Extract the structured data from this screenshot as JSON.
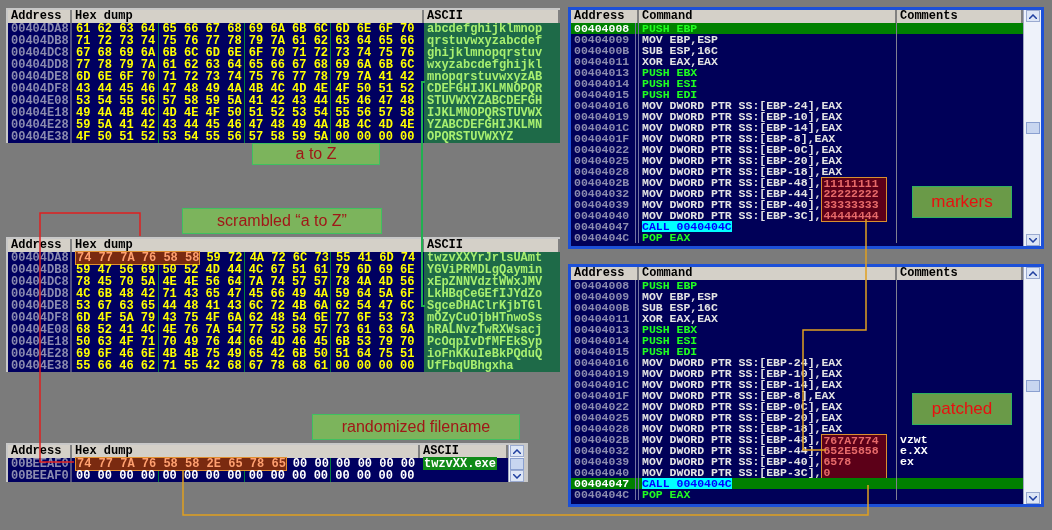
{
  "hex_panels": [
    {
      "columns": [
        "Address",
        "Hex dump",
        "ASCII"
      ],
      "rows": [
        {
          "address": "00404DA8",
          "hex": "61 62 63 64 65 66 67 68 69 6A 6B 6C 6D 6E 6F 70",
          "ascii": "abcdefghijklmnop"
        },
        {
          "address": "00404DB8",
          "hex": "71 72 73 74 75 76 77 78 79 7A 61 62 63 64 65 66",
          "ascii": "qrstuvwxyzabcdef"
        },
        {
          "address": "00404DC8",
          "hex": "67 68 69 6A 6B 6C 6D 6E 6F 70 71 72 73 74 75 76",
          "ascii": "ghijklmnopqrstuv"
        },
        {
          "address": "00404DD8",
          "hex": "77 78 79 7A 61 62 63 64 65 66 67 68 69 6A 6B 6C",
          "ascii": "wxyzabcdefghijkl"
        },
        {
          "address": "00404DE8",
          "hex": "6D 6E 6F 70 71 72 73 74 75 76 77 78 79 7A 41 42",
          "ascii": "mnopqrstuvwxyzAB"
        },
        {
          "address": "00404DF8",
          "hex": "43 44 45 46 47 48 49 4A 4B 4C 4D 4E 4F 50 51 52",
          "ascii": "CDEFGHIJKLMNOPQR"
        },
        {
          "address": "00404E08",
          "hex": "53 54 55 56 57 58 59 5A 41 42 43 44 45 46 47 48",
          "ascii": "STUVWXYZABCDEFGH"
        },
        {
          "address": "00404E18",
          "hex": "49 4A 4B 4C 4D 4E 4F 50 51 52 53 54 55 56 57 58",
          "ascii": "IJKLMNOPQRSTUVWX"
        },
        {
          "address": "00404E28",
          "hex": "59 5A 41 42 43 44 45 46 47 48 49 4A 4B 4C 4D 4E",
          "ascii": "YZABCDEFGHIJKLMN"
        },
        {
          "address": "00404E38",
          "hex": "4F 50 51 52 53 54 55 56 57 58 59 5A 00 00 00 00",
          "ascii": "OPQRSTUVWXYZ"
        }
      ]
    },
    {
      "columns": [
        "Address",
        "Hex dump",
        "ASCII"
      ],
      "rows": [
        {
          "address": "00404DA8",
          "marked": "74 77 7A 76 58 58",
          "hex": "59 72 4A 72 6C 73 55 41 6D 74",
          "ascii": "twzvXXYrJrlsUAmt"
        },
        {
          "address": "00404DB8",
          "hex": "59 47 56 69 50 52 4D 44 4C 67 51 61 79 6D 69 6E",
          "ascii": "YGViPRMDLgQaymin"
        },
        {
          "address": "00404DC8",
          "hex": "78 45 70 5A 4E 4E 56 64 7A 74 57 57 78 4A 4D 56",
          "ascii": "xEpZNNVdztWWxJMV"
        },
        {
          "address": "00404DD8",
          "hex": "4C 6B 48 42 71 43 65 47 45 66 49 4A 59 64 5A 6F",
          "ascii": "LkHBqCeGEfIJYdZo"
        },
        {
          "address": "00404DE8",
          "hex": "53 67 63 65 44 48 41 43 6C 72 4B 6A 62 54 47 6C",
          "ascii": "SgceDHAClrKjbTGl"
        },
        {
          "address": "00404DF8",
          "hex": "6D 4F 5A 79 43 75 4F 6A 62 48 54 6E 77 6F 53 73",
          "ascii": "mOZyCuOjbHTnwoSs"
        },
        {
          "address": "00404E08",
          "hex": "68 52 41 4C 4E 76 7A 54 77 52 58 57 73 61 63 6A",
          "ascii": "hRALNvzTwRXWsacj"
        },
        {
          "address": "00404E18",
          "hex": "50 63 4F 71 70 49 76 44 66 4D 46 45 6B 53 79 70",
          "ascii": "PcOqpIvDfMFEkSyp"
        },
        {
          "address": "00404E28",
          "hex": "69 6F 46 6E 4B 4B 75 49 65 42 6B 50 51 64 75 51",
          "ascii": "ioFnKKuIeBkPQduQ"
        },
        {
          "address": "00404E38",
          "hex": "55 66 46 62 71 55 42 68 67 78 68 61 00 00 00 00",
          "ascii": "UfFbqUBhgxha"
        }
      ]
    },
    {
      "columns": [
        "Address",
        "Hex dump",
        "ASCII"
      ],
      "rows": [
        {
          "address": "00BEEAE0",
          "marked": "74 77 7A 76 58 58 2E 65 78 65",
          "hex": "00 00 00 00 00 00",
          "ascii": "twzvXX.exe"
        },
        {
          "address": "00BEEAF0",
          "hex": "00 00 00 00 00 00 00 00 00 00 00 00 00 00 00 00"
        }
      ]
    }
  ],
  "disasm_panels": [
    {
      "columns": [
        "Address",
        "Command",
        "Comments"
      ],
      "rows": [
        {
          "address": "00404008",
          "command": "PUSH EBP",
          "kind": "stack",
          "selected": true
        },
        {
          "address": "00404009",
          "command": "MOV EBP,ESP",
          "kind": "plain",
          "selected": false
        },
        {
          "address": "0040400B",
          "command": "SUB ESP,16C",
          "kind": "plain",
          "selected": false
        },
        {
          "address": "00404011",
          "command": "XOR EAX,EAX",
          "kind": "plain",
          "selected": false
        },
        {
          "address": "00404013",
          "command": "PUSH EBX",
          "kind": "stack",
          "selected": false
        },
        {
          "address": "00404014",
          "command": "PUSH ESI",
          "kind": "stack",
          "selected": false
        },
        {
          "address": "00404015",
          "command": "PUSH EDI",
          "kind": "stack",
          "selected": false
        },
        {
          "address": "00404016",
          "command": "MOV DWORD PTR SS:[EBP-24],EAX",
          "kind": "plain",
          "selected": false
        },
        {
          "address": "00404019",
          "command": "MOV DWORD PTR SS:[EBP-10],EAX",
          "kind": "plain",
          "selected": false
        },
        {
          "address": "0040401C",
          "command": "MOV DWORD PTR SS:[EBP-14],EAX",
          "kind": "plain",
          "selected": false
        },
        {
          "address": "0040401F",
          "command": "MOV DWORD PTR SS:[EBP-8],EAX",
          "kind": "plain",
          "selected": false
        },
        {
          "address": "00404022",
          "command": "MOV DWORD PTR SS:[EBP-0C],EAX",
          "kind": "plain",
          "selected": false
        },
        {
          "address": "00404025",
          "command": "MOV DWORD PTR SS:[EBP-20],EAX",
          "kind": "plain",
          "selected": false
        },
        {
          "address": "00404028",
          "command": "MOV DWORD PTR SS:[EBP-18],EAX",
          "kind": "plain",
          "selected": false
        },
        {
          "address": "0040402B",
          "command": "MOV DWORD PTR SS:[EBP-48],",
          "marked": "11111111",
          "kind": "plain",
          "selected": false
        },
        {
          "address": "00404032",
          "command": "MOV DWORD PTR SS:[EBP-44],",
          "marked": "22222222",
          "kind": "plain",
          "selected": false
        },
        {
          "address": "00404039",
          "command": "MOV DWORD PTR SS:[EBP-40],",
          "marked": "33333333",
          "kind": "plain",
          "selected": false
        },
        {
          "address": "00404040",
          "command": "MOV DWORD PTR SS:[EBP-3C],",
          "marked": "44444444",
          "kind": "plain",
          "selected": false
        },
        {
          "address": "00404047",
          "command": "CALL 0040404C",
          "kind": "call",
          "selected": false
        },
        {
          "address": "0040404C",
          "command": "POP EAX",
          "kind": "stack",
          "selected": false
        }
      ]
    },
    {
      "columns": [
        "Address",
        "Command",
        "Comments"
      ],
      "rows": [
        {
          "address": "00404008",
          "command": "PUSH EBP",
          "kind": "stack",
          "selected": false
        },
        {
          "address": "00404009",
          "command": "MOV EBP,ESP",
          "kind": "plain",
          "selected": false
        },
        {
          "address": "0040400B",
          "command": "SUB ESP,16C",
          "kind": "plain",
          "selected": false
        },
        {
          "address": "00404011",
          "command": "XOR EAX,EAX",
          "kind": "plain",
          "selected": false
        },
        {
          "address": "00404013",
          "command": "PUSH EBX",
          "kind": "stack",
          "selected": false
        },
        {
          "address": "00404014",
          "command": "PUSH ESI",
          "kind": "stack",
          "selected": false
        },
        {
          "address": "00404015",
          "command": "PUSH EDI",
          "kind": "stack",
          "selected": false
        },
        {
          "address": "00404016",
          "command": "MOV DWORD PTR SS:[EBP-24],EAX",
          "kind": "plain",
          "selected": false
        },
        {
          "address": "00404019",
          "command": "MOV DWORD PTR SS:[EBP-10],EAX",
          "kind": "plain",
          "selected": false
        },
        {
          "address": "0040401C",
          "command": "MOV DWORD PTR SS:[EBP-14],EAX",
          "kind": "plain",
          "selected": false
        },
        {
          "address": "0040401F",
          "command": "MOV DWORD PTR SS:[EBP-8],EAX",
          "kind": "plain",
          "selected": false
        },
        {
          "address": "00404022",
          "command": "MOV DWORD PTR SS:[EBP-0C],EAX",
          "kind": "plain",
          "selected": false
        },
        {
          "address": "00404025",
          "command": "MOV DWORD PTR SS:[EBP-20],EAX",
          "kind": "plain",
          "selected": false
        },
        {
          "address": "00404028",
          "command": "MOV DWORD PTR SS:[EBP-18],EAX",
          "kind": "plain",
          "selected": false
        },
        {
          "address": "0040402B",
          "command": "MOV DWORD PTR SS:[EBP-48],",
          "marked": "767A7774",
          "comment": "vzwt",
          "kind": "plain",
          "selected": false
        },
        {
          "address": "00404032",
          "command": "MOV DWORD PTR SS:[EBP-44],",
          "marked": "652E5858",
          "comment": "e.XX",
          "kind": "plain",
          "selected": false
        },
        {
          "address": "00404039",
          "command": "MOV DWORD PTR SS:[EBP-40],",
          "marked": "6578",
          "comment": "ex",
          "kind": "plain",
          "selected": false
        },
        {
          "address": "00404040",
          "command": "MOV DWORD PTR SS:[EBP-3C],",
          "marked": "0",
          "kind": "plain",
          "selected": false
        },
        {
          "address": "00404047",
          "command": "CALL 0040404C",
          "kind": "call",
          "selected": true
        },
        {
          "address": "0040404C",
          "command": "POP EAX",
          "kind": "stack",
          "selected": false
        }
      ]
    }
  ],
  "callouts": [
    {
      "text": "a to Z"
    },
    {
      "text": "scrambled “a to Z”"
    },
    {
      "text": "randomized filename"
    },
    {
      "text": "markers"
    },
    {
      "text": "patched"
    }
  ]
}
